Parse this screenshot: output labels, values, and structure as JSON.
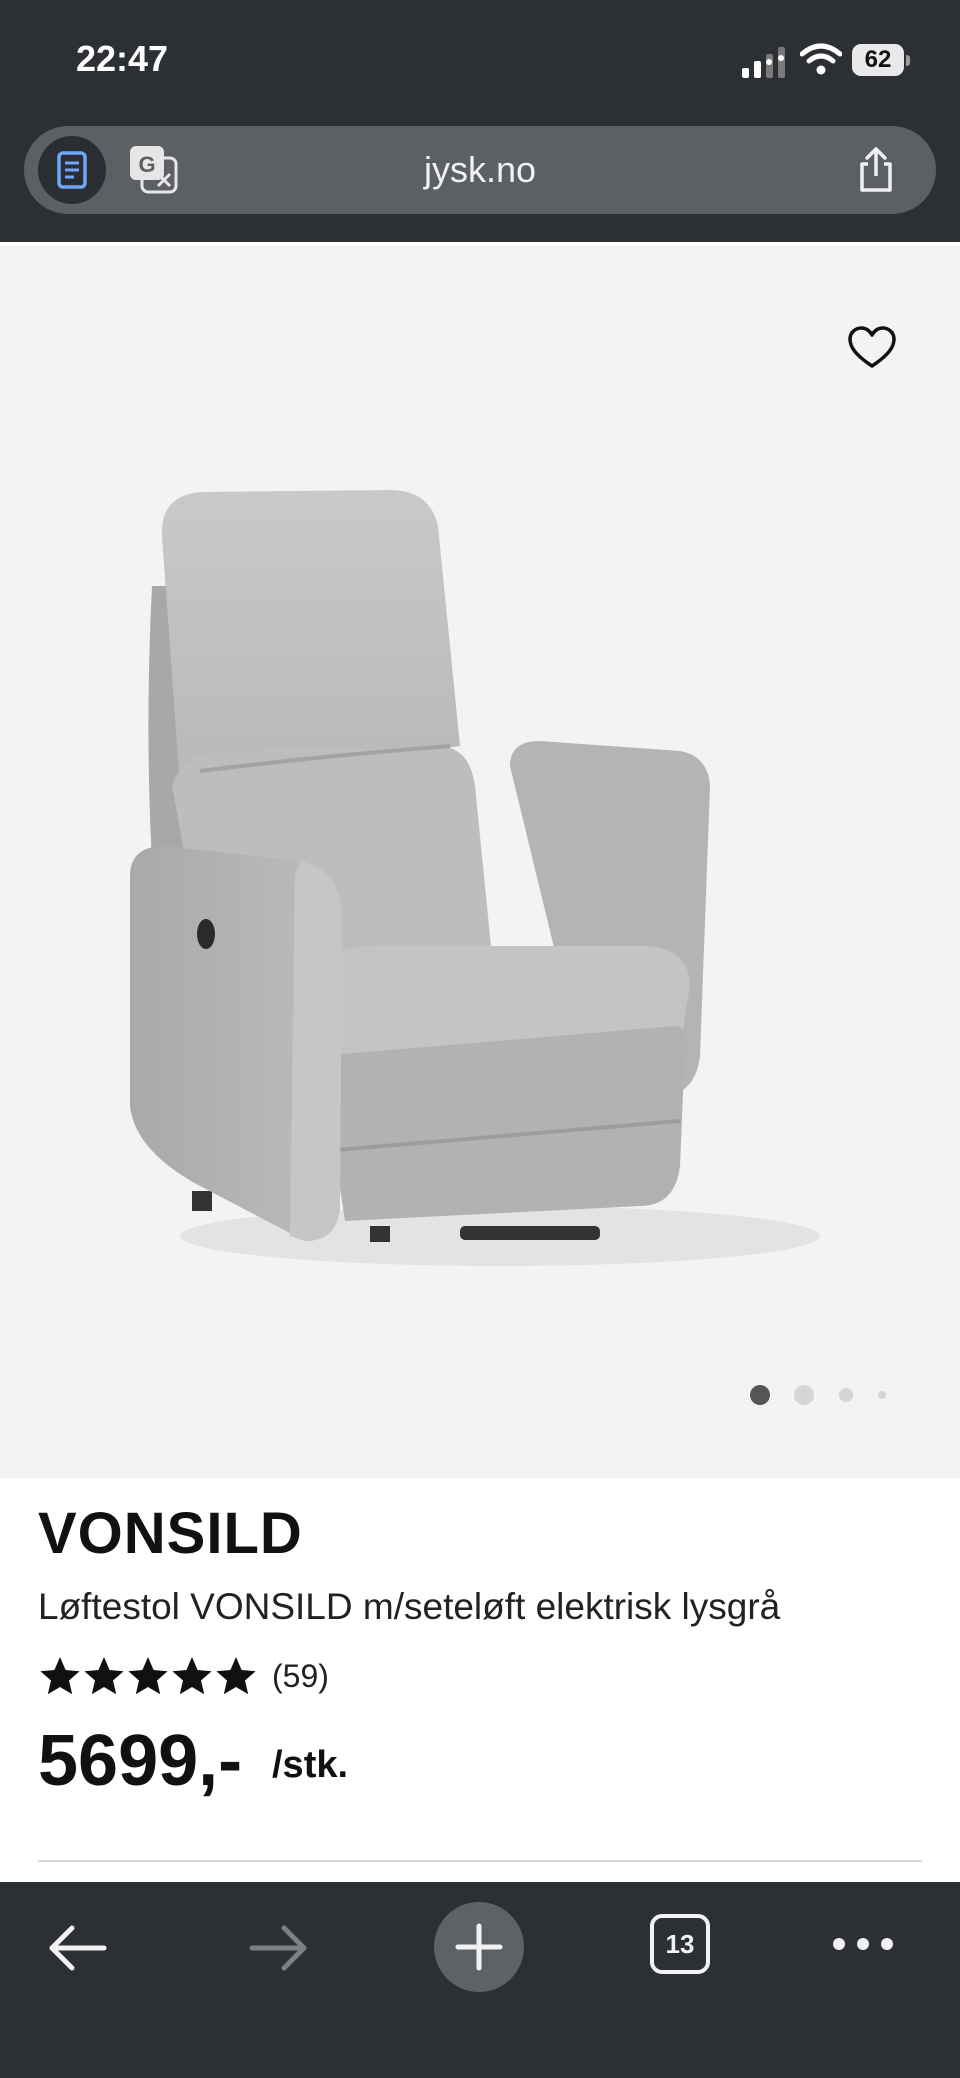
{
  "status_bar": {
    "time": "22:47",
    "battery": "62"
  },
  "browser": {
    "url": "jysk.no",
    "tab_count": "13"
  },
  "product": {
    "brand": "VONSILD",
    "description": "Løftestol VONSILD m/seteløft elektrisk lysgrå",
    "rating": 5,
    "review_count": "(59)",
    "price": "5699,-",
    "unit": "/stk."
  },
  "carousel": {
    "dot_count": 4,
    "active_index": 0
  },
  "icons": [
    "reader-icon",
    "translate-icon",
    "share-icon",
    "heart-icon",
    "star-icon",
    "back-arrow-icon",
    "forward-arrow-icon",
    "plus-icon",
    "more-icon"
  ],
  "colors": {
    "chrome": "#2c2f33",
    "hero_bg": "#f3f3f3",
    "text": "#111111"
  }
}
